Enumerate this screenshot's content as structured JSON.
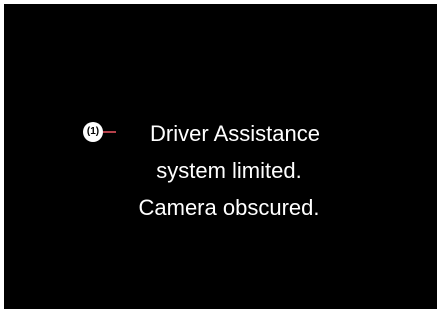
{
  "callout": {
    "label": "(1)"
  },
  "message": {
    "line_1": "Driver Assistance",
    "line_2": "system limited.",
    "line_3": "Camera obscured."
  },
  "colors": {
    "background": "#000000",
    "text": "#ffffff",
    "callout_line": "#b5404a"
  }
}
